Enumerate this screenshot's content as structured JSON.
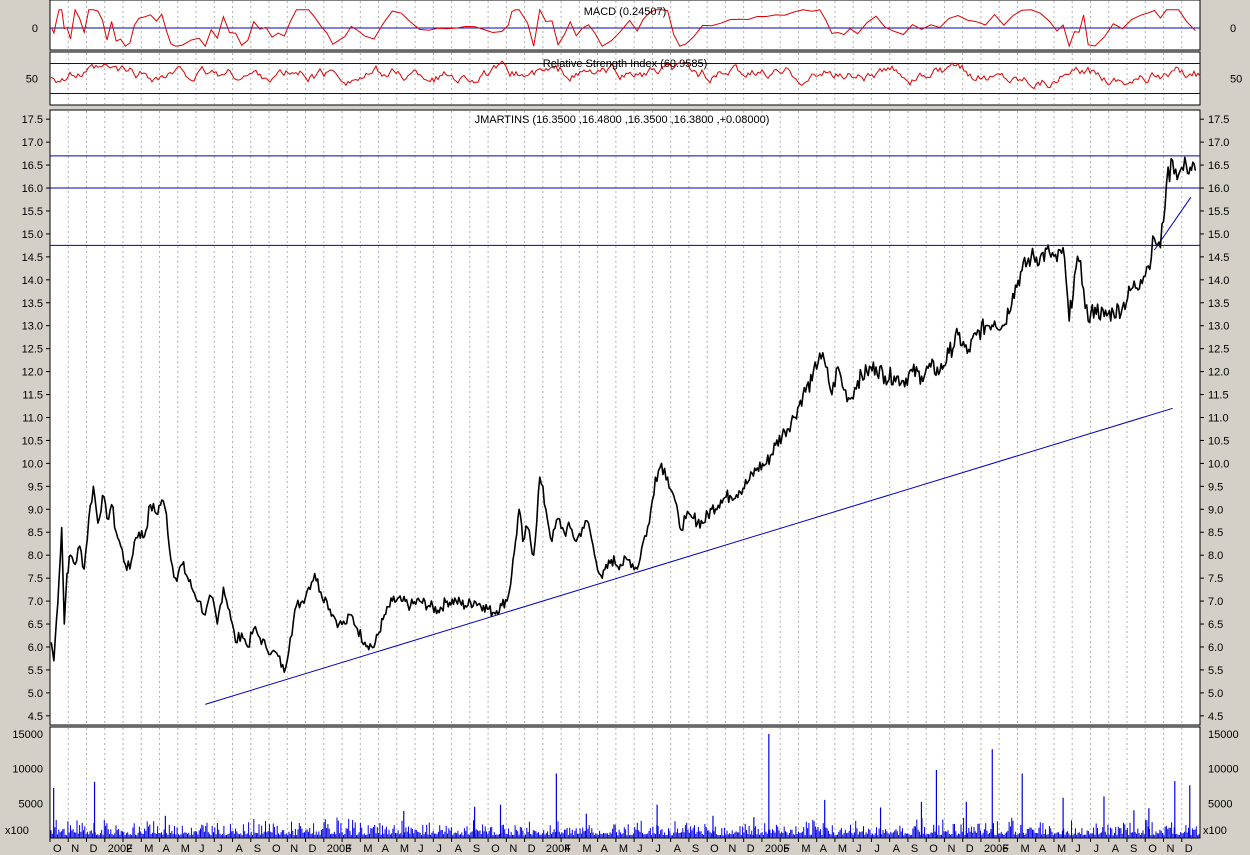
{
  "chart_data": [
    {
      "type": "line",
      "title": "MACD (0.24507)",
      "yticks": [
        "0"
      ],
      "zero_line": 0,
      "colors": {
        "line": "#e00000",
        "ref": "#0000c0"
      }
    },
    {
      "type": "line",
      "title": "Relative Strength Index (60.9585)",
      "yticks": [
        "50"
      ],
      "reference_lines": [
        70,
        30
      ],
      "colors": {
        "line": "#e00000",
        "ref": "#0000c0"
      }
    },
    {
      "type": "line",
      "title": "JMARTINS (16.3500 ,16.4800 ,16.3500 ,16.3800 ,+0.08000)",
      "ylim": [
        4.3,
        17.7
      ],
      "yticks": [
        "17.5",
        "17.0",
        "16.5",
        "16.0",
        "15.5",
        "15.0",
        "14.5",
        "14.0",
        "13.5",
        "13.0",
        "12.5",
        "12.0",
        "11.5",
        "11.0",
        "10.5",
        "10.0",
        "9.5",
        "9.0",
        "8.5",
        "8.0",
        "7.5",
        "7.0",
        "6.5",
        "6.0",
        "5.5",
        "5.0",
        "4.5"
      ],
      "x_ticks": [
        "O",
        "N",
        "D",
        "2002",
        "F",
        "M",
        "A",
        "M",
        "J",
        "J",
        "A",
        "S",
        "O",
        "N",
        "D",
        "2003",
        "F",
        "M",
        "A",
        "M",
        "J",
        "J",
        "A",
        "S",
        "O",
        "N",
        "D",
        "2004",
        "F",
        "M",
        "A",
        "M",
        "J",
        "J",
        "A",
        "S",
        "O",
        "N",
        "D",
        "2005",
        "F",
        "M",
        "A",
        "M",
        "J",
        "J",
        "A",
        "S",
        "O",
        "N",
        "D",
        "2006",
        "F",
        "M",
        "A",
        "M",
        "J",
        "J",
        "A",
        "S",
        "O",
        "N",
        "D"
      ],
      "x_start_month": "2001-10",
      "horizontal_lines": [
        16.7,
        16.0,
        14.75
      ],
      "trend_lines": [
        {
          "from": [
            "2002-06",
            4.75
          ],
          "to": [
            "2006-11",
            11.2
          ]
        },
        {
          "from": [
            "2006-10",
            14.65
          ],
          "to": [
            "2006-12",
            15.8
          ]
        }
      ],
      "series": [
        {
          "points": [
            [
              "2001-10",
              6.1
            ],
            [
              "2001-10",
              5.7
            ],
            [
              "2001-10",
              6.6
            ],
            [
              "2001-10",
              7.5
            ],
            [
              "2001-10",
              8.6
            ],
            [
              "2001-10",
              6.5
            ],
            [
              "2001-10",
              7.6
            ],
            [
              "2001-11",
              8.0
            ],
            [
              "2001-11",
              7.8
            ],
            [
              "2001-11",
              8.2
            ],
            [
              "2001-11",
              7.7
            ],
            [
              "2001-12",
              8.8
            ],
            [
              "2001-12",
              9.5
            ],
            [
              "2001-12",
              8.7
            ],
            [
              "2001-12",
              9.3
            ],
            [
              "2002-01",
              8.8
            ],
            [
              "2002-01",
              9.1
            ],
            [
              "2002-01",
              8.5
            ],
            [
              "2002-01",
              8.2
            ],
            [
              "2002-02",
              7.8
            ],
            [
              "2002-02",
              7.7
            ],
            [
              "2002-02",
              8.3
            ],
            [
              "2002-02",
              8.5
            ],
            [
              "2002-03",
              8.4
            ],
            [
              "2002-03",
              9.1
            ],
            [
              "2002-03",
              8.9
            ],
            [
              "2002-04",
              9.2
            ],
            [
              "2002-04",
              8.9
            ],
            [
              "2002-04",
              7.9
            ],
            [
              "2002-04",
              7.5
            ],
            [
              "2002-05",
              7.8
            ],
            [
              "2002-05",
              7.3
            ],
            [
              "2002-06",
              7.0
            ],
            [
              "2002-06",
              6.7
            ],
            [
              "2002-06",
              7.1
            ],
            [
              "2002-07",
              6.5
            ],
            [
              "2002-07",
              7.3
            ],
            [
              "2002-07",
              6.8
            ],
            [
              "2002-08",
              6.1
            ],
            [
              "2002-08",
              6.3
            ],
            [
              "2002-08",
              6.0
            ],
            [
              "2002-09",
              6.4
            ],
            [
              "2002-09",
              6.2
            ],
            [
              "2002-09",
              6.0
            ],
            [
              "2002-10",
              5.9
            ],
            [
              "2002-10",
              5.8
            ],
            [
              "2002-10",
              5.45
            ],
            [
              "2002-11",
              6.2
            ],
            [
              "2002-11",
              6.9
            ],
            [
              "2002-11",
              7.0
            ],
            [
              "2002-12",
              7.3
            ],
            [
              "2002-12",
              7.6
            ],
            [
              "2002-12",
              7.2
            ],
            [
              "2003-01",
              7.0
            ],
            [
              "2003-01",
              6.7
            ],
            [
              "2003-01",
              6.5
            ],
            [
              "2003-02",
              6.5
            ],
            [
              "2003-02",
              6.7
            ],
            [
              "2003-02",
              6.4
            ],
            [
              "2003-03",
              6.1
            ],
            [
              "2003-03",
              6.0
            ],
            [
              "2003-04",
              6.6
            ],
            [
              "2003-04",
              7.0
            ],
            [
              "2003-05",
              7.0
            ],
            [
              "2003-05",
              6.9
            ],
            [
              "2003-06",
              7.0
            ],
            [
              "2003-06",
              6.9
            ],
            [
              "2003-07",
              6.8
            ],
            [
              "2003-07",
              7.0
            ],
            [
              "2003-08",
              7.0
            ],
            [
              "2003-08",
              6.9
            ],
            [
              "2003-09",
              7.0
            ],
            [
              "2003-09",
              6.9
            ],
            [
              "2003-10",
              6.75
            ],
            [
              "2003-10",
              6.9
            ],
            [
              "2003-11",
              7.1
            ],
            [
              "2003-11",
              7.6
            ],
            [
              "2003-11",
              8.3
            ],
            [
              "2003-11",
              9.0
            ],
            [
              "2003-11",
              8.3
            ],
            [
              "2003-12",
              8.6
            ],
            [
              "2003-12",
              8.0
            ],
            [
              "2003-12",
              9.7
            ],
            [
              "2004-01",
              9.0
            ],
            [
              "2004-01",
              8.3
            ],
            [
              "2004-01",
              8.8
            ],
            [
              "2004-02",
              8.5
            ],
            [
              "2004-02",
              8.6
            ],
            [
              "2004-02",
              8.3
            ],
            [
              "2004-03",
              8.6
            ],
            [
              "2004-03",
              8.7
            ],
            [
              "2004-03",
              8.0
            ],
            [
              "2004-04",
              7.5
            ],
            [
              "2004-04",
              7.9
            ],
            [
              "2004-05",
              7.8
            ],
            [
              "2004-05",
              7.9
            ],
            [
              "2004-06",
              7.7
            ],
            [
              "2004-06",
              8.3
            ],
            [
              "2004-06",
              8.7
            ],
            [
              "2004-07",
              9.7
            ],
            [
              "2004-07",
              10.0
            ],
            [
              "2004-07",
              9.7
            ],
            [
              "2004-08",
              9.3
            ],
            [
              "2004-08",
              8.6
            ],
            [
              "2004-08",
              8.8
            ],
            [
              "2004-09",
              8.8
            ],
            [
              "2004-09",
              8.7
            ],
            [
              "2004-10",
              9.0
            ],
            [
              "2004-10",
              9.2
            ],
            [
              "2004-11",
              9.3
            ],
            [
              "2004-11",
              9.4
            ],
            [
              "2004-12",
              9.6
            ],
            [
              "2004-12",
              9.9
            ],
            [
              "2005-01",
              10.0
            ],
            [
              "2005-01",
              10.4
            ],
            [
              "2005-02",
              10.7
            ],
            [
              "2005-02",
              11.0
            ],
            [
              "2005-03",
              11.5
            ],
            [
              "2005-03",
              11.8
            ],
            [
              "2005-04",
              12.4
            ],
            [
              "2005-04",
              12.1
            ],
            [
              "2005-04",
              11.5
            ],
            [
              "2005-05",
              12.1
            ],
            [
              "2005-05",
              11.6
            ],
            [
              "2005-05",
              11.4
            ],
            [
              "2005-06",
              11.8
            ],
            [
              "2005-06",
              12.0
            ],
            [
              "2005-07",
              12.1
            ],
            [
              "2005-07",
              11.9
            ],
            [
              "2005-08",
              11.9
            ],
            [
              "2005-08",
              11.8
            ],
            [
              "2005-09",
              12.0
            ],
            [
              "2005-09",
              11.9
            ],
            [
              "2005-10",
              12.1
            ],
            [
              "2005-10",
              12.0
            ],
            [
              "2005-11",
              12.4
            ],
            [
              "2005-11",
              12.8
            ],
            [
              "2005-12",
              12.4
            ],
            [
              "2005-12",
              12.8
            ],
            [
              "2006-01",
              13.0
            ],
            [
              "2006-01",
              13.1
            ],
            [
              "2006-02",
              13.0
            ],
            [
              "2006-02",
              13.7
            ],
            [
              "2006-03",
              14.2
            ],
            [
              "2006-03",
              14.5
            ],
            [
              "2006-04",
              14.5
            ],
            [
              "2006-04",
              14.6
            ],
            [
              "2006-05",
              14.4
            ],
            [
              "2006-05",
              14.7
            ],
            [
              "2006-05",
              13.1
            ],
            [
              "2006-06",
              14.1
            ],
            [
              "2006-06",
              14.4
            ],
            [
              "2006-06",
              13.8
            ],
            [
              "2006-06",
              13.1
            ],
            [
              "2006-07",
              13.4
            ],
            [
              "2006-07",
              13.2
            ],
            [
              "2006-08",
              13.3
            ],
            [
              "2006-08",
              13.4
            ],
            [
              "2006-09",
              13.8
            ],
            [
              "2006-09",
              14.0
            ],
            [
              "2006-10",
              14.3
            ],
            [
              "2006-10",
              14.9
            ],
            [
              "2006-10",
              14.7
            ],
            [
              "2006-11",
              16.1
            ],
            [
              "2006-11",
              16.6
            ],
            [
              "2006-11",
              16.3
            ],
            [
              "2006-12",
              16.5
            ],
            [
              "2006-12",
              16.38
            ]
          ]
        }
      ],
      "colors": {
        "price": "#000000",
        "lines": "#0000c0"
      }
    },
    {
      "type": "bar",
      "title": "",
      "ylim": [
        0,
        16000
      ],
      "yticks": [
        "15000",
        "10000",
        "5000"
      ],
      "unit_label": "x100",
      "spikes": [
        [
          "2001-10",
          7200
        ],
        [
          "2001-12",
          8100
        ],
        [
          "2002-04",
          3200
        ],
        [
          "2003-05",
          3900
        ],
        [
          "2003-09",
          4500
        ],
        [
          "2003-10",
          4800
        ],
        [
          "2004-01",
          9300
        ],
        [
          "2004-03",
          3500
        ],
        [
          "2004-07",
          4800
        ],
        [
          "2004-10",
          3200
        ],
        [
          "2004-12",
          3000
        ],
        [
          "2005-01",
          15000
        ],
        [
          "2005-04",
          5500
        ],
        [
          "2005-07",
          4400
        ],
        [
          "2005-09",
          5200
        ],
        [
          "2005-10",
          9800
        ],
        [
          "2005-12",
          5200
        ],
        [
          "2006-01",
          12800
        ],
        [
          "2006-03",
          9300
        ],
        [
          "2006-05",
          5800
        ],
        [
          "2006-07",
          6000
        ],
        [
          "2006-09",
          4000
        ],
        [
          "2006-10",
          4300
        ],
        [
          "2006-11",
          8200
        ],
        [
          "2006-12",
          7600
        ]
      ],
      "colors": {
        "bars": "#0000e0"
      }
    }
  ]
}
